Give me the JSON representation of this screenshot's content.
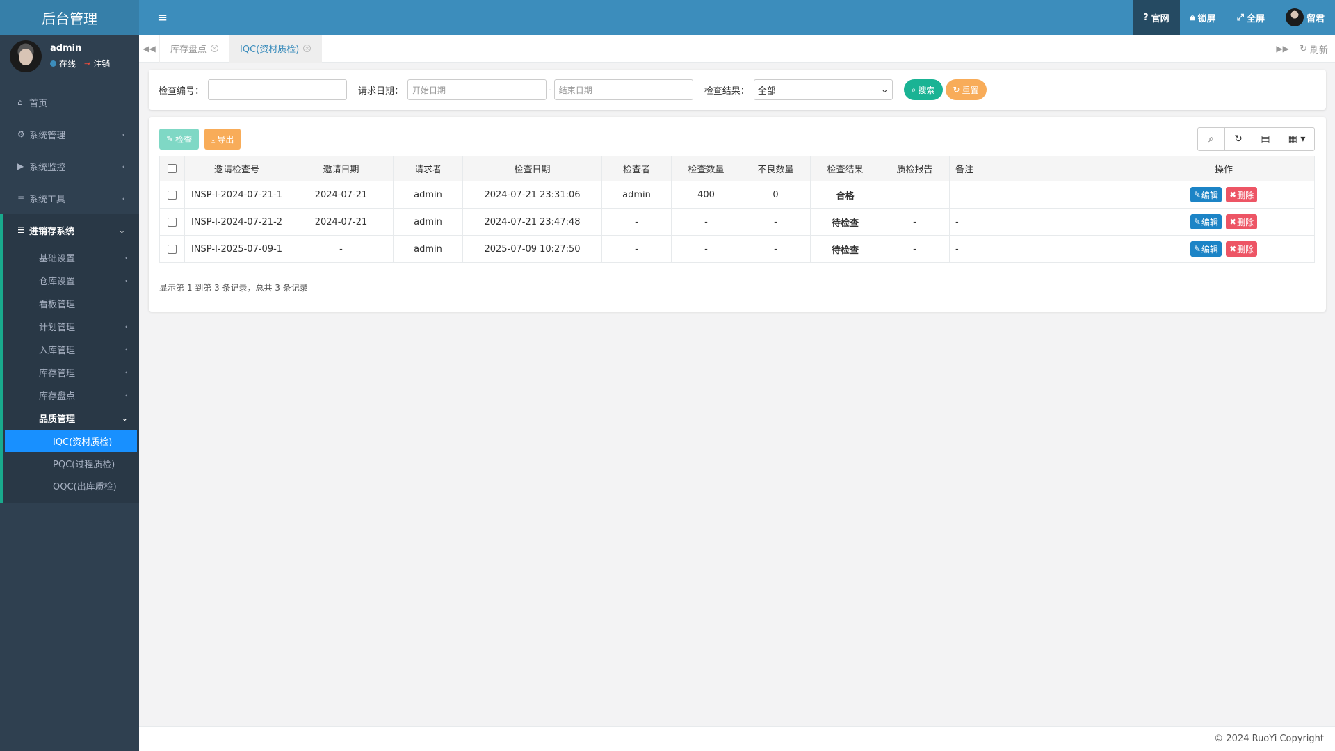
{
  "brand": "后台管理",
  "user": {
    "name": "admin",
    "status": "在线",
    "logout": "注销"
  },
  "menu": {
    "home": "首页",
    "system": "系统管理",
    "monitor": "系统监控",
    "tools": "系统工具",
    "erp": "进销存系统",
    "erp_items": [
      "基础设置",
      "仓库设置",
      "看板管理",
      "计划管理",
      "入库管理",
      "库存管理",
      "库存盘点",
      "品质管理"
    ],
    "quality_items": [
      "IQC(资材质检)",
      "PQC(过程质检)",
      "OQC(出库质检)"
    ]
  },
  "topbar": {
    "website": "官网",
    "lock": "锁屏",
    "fullscreen": "全屏",
    "username": "留君"
  },
  "tabs": {
    "tab1": "库存盘点",
    "tab2": "IQC(资材质检)",
    "refresh": "刷新"
  },
  "search": {
    "code_label": "检查编号：",
    "date_label": "请求日期：",
    "start_placeholder": "开始日期",
    "date_sep": "-",
    "end_placeholder": "结束日期",
    "result_label": "检查结果：",
    "result_value": "全部",
    "search_btn": "搜索",
    "reset_btn": "重置"
  },
  "toolbar": {
    "check_btn": "检查",
    "export_btn": "导出"
  },
  "table": {
    "headers": [
      "邀请检查号",
      "邀请日期",
      "请求者",
      "检查日期",
      "检查者",
      "检查数量",
      "不良数量",
      "检查结果",
      "质检报告",
      "备注",
      "操作"
    ],
    "rows": [
      {
        "code": "INSP-I-2024-07-21-1",
        "invite_date": "2024-07-21",
        "requester": "admin",
        "check_date": "2024-07-21 23:31:06",
        "checker": "admin",
        "qty": "400",
        "bad": "0",
        "result": "合格",
        "report": "",
        "note": ""
      },
      {
        "code": "INSP-I-2024-07-21-2",
        "invite_date": "2024-07-21",
        "requester": "admin",
        "check_date": "2024-07-21 23:47:48",
        "checker": "-",
        "qty": "-",
        "bad": "-",
        "result": "待检查",
        "report": "-",
        "note": "-"
      },
      {
        "code": "INSP-I-2025-07-09-1",
        "invite_date": "-",
        "requester": "admin",
        "check_date": "2025-07-09 10:27:50",
        "checker": "-",
        "qty": "-",
        "bad": "-",
        "result": "待检查",
        "report": "-",
        "note": "-"
      }
    ],
    "edit": "编辑",
    "delete": "删除"
  },
  "page_info": "显示第 1 到第 3 条记录，总共 3 条记录",
  "footer": "© 2024 RuoYi Copyright"
}
